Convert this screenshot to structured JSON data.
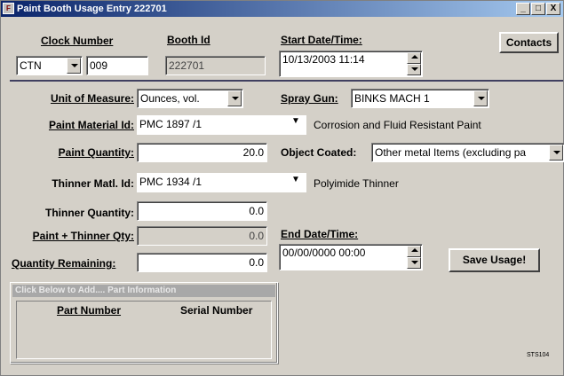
{
  "window": {
    "title": "Paint Booth Usage Entry 222701",
    "icon_glyph": "F",
    "min_glyph": "_",
    "max_glyph": "□",
    "close_glyph": "X"
  },
  "header": {
    "clock_number_label": "Clock Number",
    "clock_prefix_value": "CTN",
    "clock_number_value": "009",
    "booth_id_label": "Booth Id",
    "booth_id_value": "222701",
    "start_label": "Start Date/Time:",
    "start_value": "10/13/2003 11:14",
    "contacts_button": "Contacts"
  },
  "form": {
    "unit_label": "Unit of Measure:",
    "unit_value": "Ounces, vol.",
    "spray_gun_label": "Spray Gun:",
    "spray_gun_value": "BINKS MACH 1",
    "paint_material_label": "Paint Material Id:",
    "paint_material_value": "PMC 1897 /1",
    "paint_material_desc": "Corrosion and Fluid Resistant Paint",
    "paint_qty_label": "Paint Quantity:",
    "paint_qty_value": "20.0",
    "object_coated_label": "Object Coated:",
    "object_coated_value": "Other metal Items (excluding pa",
    "thinner_matl_label": "Thinner Matl. Id:",
    "thinner_matl_value": "PMC 1934 /1",
    "thinner_desc": "Polyimide Thinner",
    "thinner_qty_label": "Thinner Quantity:",
    "thinner_qty_value": "0.0",
    "paint_thinner_label": "Paint + Thinner Qty:",
    "paint_thinner_value": "0.0",
    "end_label": "End Date/Time:",
    "end_value": "00/00/0000 00:00",
    "qty_remaining_label": "Quantity Remaining:",
    "qty_remaining_value": "0.0",
    "save_button": "Save Usage!"
  },
  "parts": {
    "group_title": "Click Below to Add.... Part Information",
    "col_part_number": "Part Number",
    "col_serial_number": "Serial Number"
  },
  "footer": {
    "form_code": "STS104"
  }
}
